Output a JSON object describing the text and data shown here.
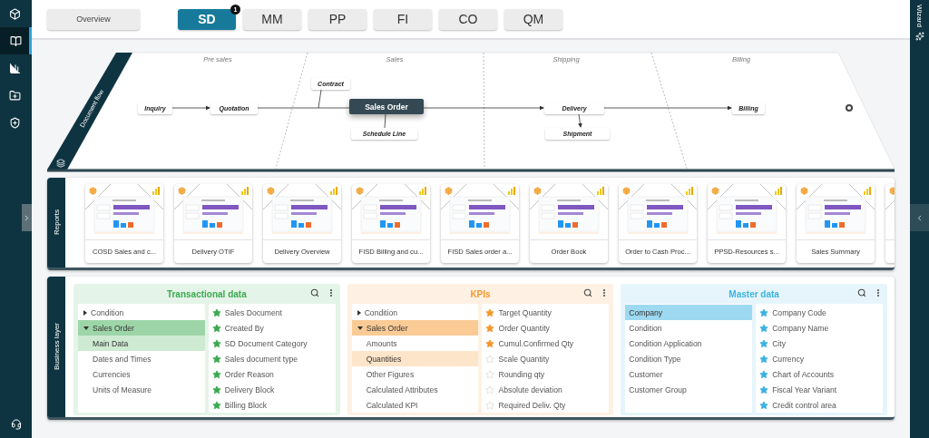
{
  "sidebar": {
    "items": [
      {
        "selected": false
      },
      {
        "selected": true
      },
      {
        "selected": false
      },
      {
        "selected": false
      },
      {
        "selected": false
      }
    ]
  },
  "top_bar": {
    "overview_button": "Overview",
    "tabs": [
      {
        "label": "SD",
        "selected": true,
        "badge": "1"
      },
      {
        "label": "MM",
        "selected": false
      },
      {
        "label": "PP",
        "selected": false
      },
      {
        "label": "FI",
        "selected": false
      },
      {
        "label": "CO",
        "selected": false
      },
      {
        "label": "QM",
        "selected": false
      }
    ]
  },
  "document_flow": {
    "label": "Document flow",
    "lanes": [
      "Pre sales",
      "Sales",
      "Shipping",
      "Billing"
    ],
    "nodes": [
      {
        "label": "Inquiry",
        "selected": false
      },
      {
        "label": "Quotation",
        "selected": false
      },
      {
        "label": "Contract",
        "selected": false
      },
      {
        "label": "Sales Order",
        "selected": true
      },
      {
        "label": "Schedule Line",
        "selected": false
      },
      {
        "label": "Delivery",
        "selected": false
      },
      {
        "label": "Shipment",
        "selected": false
      },
      {
        "label": "Billing",
        "selected": false
      }
    ]
  },
  "reports": {
    "label": "Reports",
    "cards": [
      "COSD Sales and c...",
      "Delivery OTIF",
      "Delivery Overview",
      "FISD Billing and cu...",
      "FISD Sales order a...",
      "Order Book",
      "Order to Cash Proc...",
      "PPSD-Resources s...",
      "Sales Summary"
    ]
  },
  "business_layer": {
    "label": "Business layer",
    "panels": [
      {
        "title": "Transactional data",
        "color": "#3aaa50",
        "tree": [
          {
            "label": "Condition",
            "expanded": false
          },
          {
            "label": "Sales Order",
            "expanded": true,
            "children": [
              {
                "label": "Main Data",
                "selected": true
              },
              {
                "label": "Dates and Times",
                "selected": false
              },
              {
                "label": "Currencies",
                "selected": false
              },
              {
                "label": "Units of Measure",
                "selected": false
              }
            ]
          }
        ],
        "fields": [
          {
            "label": "Sales Document",
            "starred": true
          },
          {
            "label": "Created By",
            "starred": true
          },
          {
            "label": "SD Document Category",
            "starred": true
          },
          {
            "label": "Sales document type",
            "starred": true
          },
          {
            "label": "Order Reason",
            "starred": true
          },
          {
            "label": "Delivery Block",
            "starred": true
          },
          {
            "label": "Billing Block",
            "starred": true
          }
        ]
      },
      {
        "title": "KPIs",
        "color": "#f5962a",
        "tree": [
          {
            "label": "Condition",
            "expanded": false
          },
          {
            "label": "Sales Order",
            "expanded": true,
            "children": [
              {
                "label": "Amounts",
                "selected": false
              },
              {
                "label": "Quantities",
                "selected": true
              },
              {
                "label": "Other Figures",
                "selected": false
              },
              {
                "label": "Calculated Attributes",
                "selected": false
              },
              {
                "label": "Calculated KPI",
                "selected": false
              }
            ]
          }
        ],
        "fields": [
          {
            "label": "Target Quantity",
            "starred": true
          },
          {
            "label": "Order Quantity",
            "starred": true
          },
          {
            "label": "Cumul.Confirmed Qty",
            "starred": true
          },
          {
            "label": "Scale Quantity",
            "starred": false
          },
          {
            "label": "Rounding qty",
            "starred": false
          },
          {
            "label": "Absolute deviation",
            "starred": false
          },
          {
            "label": "Required Deliv. Qty",
            "starred": false
          }
        ]
      },
      {
        "title": "Master data",
        "color": "#3bb2e0",
        "tree": [
          {
            "label": "Company",
            "selected": true
          },
          {
            "label": "Condition",
            "selected": false
          },
          {
            "label": "Condition Application",
            "selected": false
          },
          {
            "label": "Condition Type",
            "selected": false
          },
          {
            "label": "Customer",
            "selected": false
          },
          {
            "label": "Customer Group",
            "selected": false
          }
        ],
        "fields": [
          {
            "label": "Company Code",
            "starred": true
          },
          {
            "label": "Company Name",
            "starred": true
          },
          {
            "label": "City",
            "starred": true
          },
          {
            "label": "Currency",
            "starred": true
          },
          {
            "label": "Chart of Accounts",
            "starred": true
          },
          {
            "label": "Fiscal Year Variant",
            "starred": true
          },
          {
            "label": "Credit control area",
            "starred": true
          }
        ]
      }
    ]
  },
  "wizard": {
    "label": "Wizard"
  }
}
